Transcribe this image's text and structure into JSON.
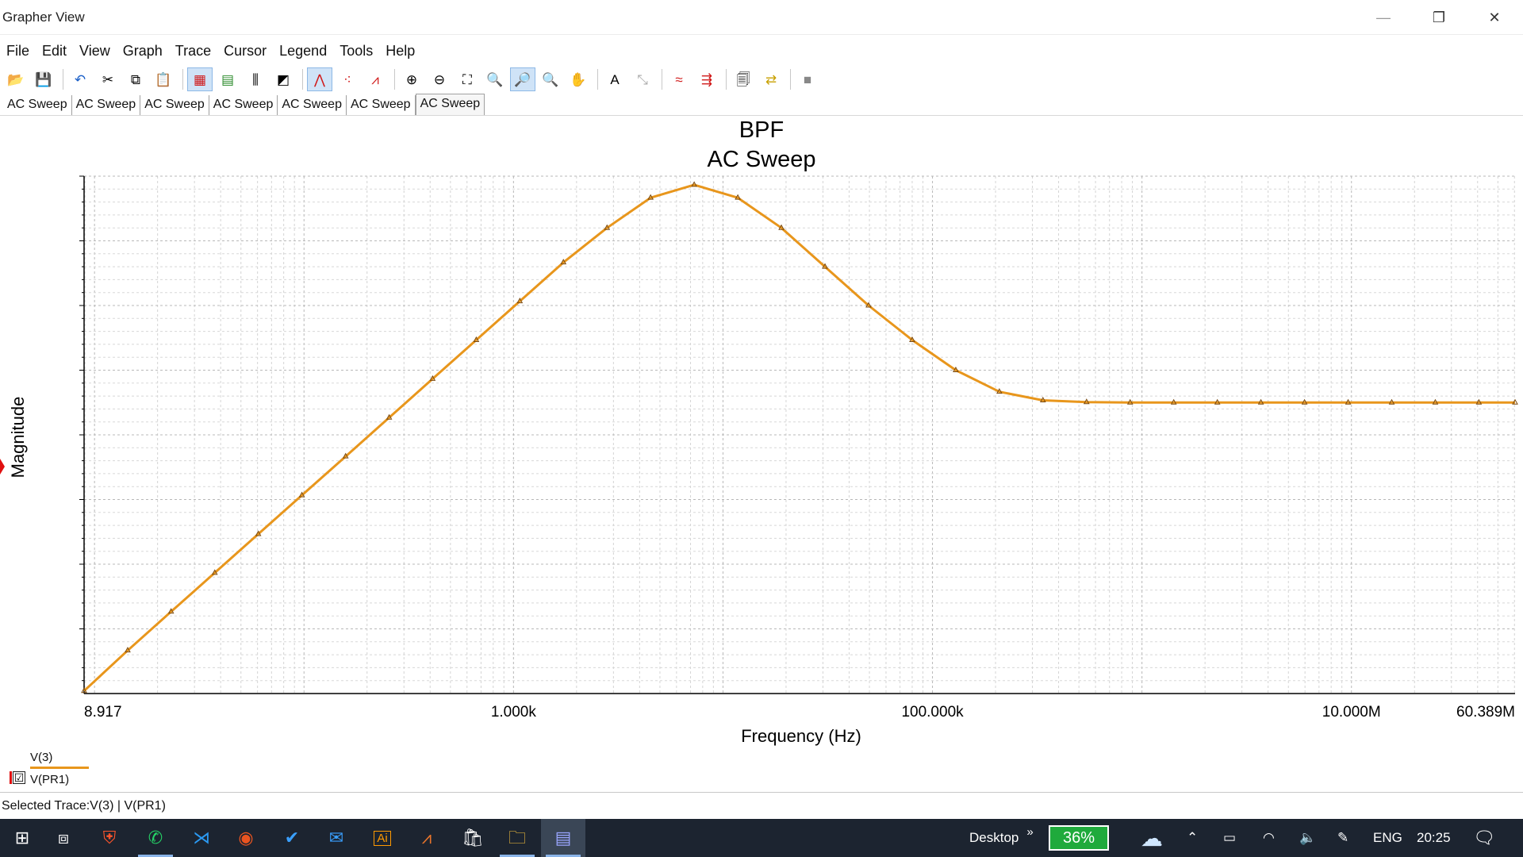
{
  "window": {
    "title": "Grapher View",
    "minimize_glyph": "—",
    "restore_glyph": "❐",
    "close_glyph": "✕"
  },
  "menu": [
    "File",
    "Edit",
    "View",
    "Graph",
    "Trace",
    "Cursor",
    "Legend",
    "Tools",
    "Help"
  ],
  "toolbar": [
    {
      "name": "open-icon",
      "glyph": "📂"
    },
    {
      "name": "save-icon",
      "glyph": "💾"
    },
    {
      "sep": true
    },
    {
      "name": "undo-icon",
      "glyph": "↶",
      "color": "#1a5fc8"
    },
    {
      "name": "cut-icon",
      "glyph": "✂"
    },
    {
      "name": "copy-icon",
      "glyph": "⧉"
    },
    {
      "name": "paste-icon",
      "glyph": "📋"
    },
    {
      "sep": true
    },
    {
      "name": "grid-icon",
      "glyph": "▦",
      "color": "#d01818",
      "active": true
    },
    {
      "name": "legend-icon",
      "glyph": "▤",
      "color": "#2a8a2a"
    },
    {
      "name": "ticks-icon",
      "glyph": "⫼"
    },
    {
      "name": "properties-icon",
      "glyph": "◩"
    },
    {
      "sep": true
    },
    {
      "name": "line-style-icon",
      "glyph": "⋀",
      "color": "#d01818",
      "active": true
    },
    {
      "name": "dot-style-icon",
      "glyph": "⁖",
      "color": "#d01818"
    },
    {
      "name": "line-dot-style-icon",
      "glyph": "⩘",
      "color": "#d01818"
    },
    {
      "sep": true
    },
    {
      "name": "zoom-in-icon",
      "glyph": "⊕"
    },
    {
      "name": "zoom-out-icon",
      "glyph": "⊖"
    },
    {
      "name": "zoom-area-icon",
      "glyph": "⛶"
    },
    {
      "name": "zoom-full-icon",
      "glyph": "🔍"
    },
    {
      "name": "zoom-x-icon",
      "glyph": "🔎",
      "active": true
    },
    {
      "name": "zoom-y-icon",
      "glyph": "🔍"
    },
    {
      "name": "pan-hand-icon",
      "glyph": "✋"
    },
    {
      "sep": true
    },
    {
      "name": "text-tool-icon",
      "glyph": "A"
    },
    {
      "name": "label-tool-icon",
      "glyph": "⤡",
      "color": "#aaaaaa"
    },
    {
      "sep": true
    },
    {
      "name": "overlay-traces-icon",
      "glyph": "≈",
      "color": "#d01818"
    },
    {
      "name": "export-icon",
      "glyph": "⇶",
      "color": "#d01818"
    },
    {
      "sep": true
    },
    {
      "name": "print-preview-icon",
      "glyph": "🗐"
    },
    {
      "name": "transfer-icon",
      "glyph": "⇄",
      "color": "#c8a000"
    },
    {
      "sep": true
    },
    {
      "name": "stop-icon",
      "glyph": "■",
      "color": "#888888"
    }
  ],
  "tabs": [
    "AC Sweep",
    "AC Sweep",
    "AC Sweep",
    "AC Sweep",
    "AC Sweep",
    "AC Sweep",
    "AC Sweep"
  ],
  "active_tab": 6,
  "chart_data": {
    "type": "line",
    "title": "BPF",
    "subtitle": "AC Sweep",
    "xlabel": "Frequency (Hz)",
    "ylabel": "Magnitude",
    "x_scale": "log",
    "xlim": [
      8.917,
      60389000
    ],
    "x_tick_values": [
      8.917,
      1000,
      100000,
      10000000,
      60389000
    ],
    "x_tick_labels": [
      "8.917",
      "1.000k",
      "100.000k",
      "10.000M",
      "60.389M"
    ],
    "y_tick_labels": [],
    "ylim": [
      0,
      1.2
    ],
    "grid": true,
    "trace_color": "#e8961c",
    "series": [
      {
        "name": "V(3)",
        "x": [
          8.917,
          14.4,
          23.2,
          37.5,
          60.5,
          97.7,
          158,
          255,
          411,
          664,
          1072,
          1731,
          2795,
          4513,
          7287,
          11770,
          19000,
          30680,
          49540,
          80000,
          129200,
          208600,
          336800,
          543800,
          878100,
          1418000,
          2290000,
          3697000,
          5970000,
          9640000,
          15570000,
          25130000,
          40580000,
          60389000
        ],
        "y": [
          0.006,
          0.1,
          0.19,
          0.28,
          0.37,
          0.46,
          0.55,
          0.64,
          0.73,
          0.82,
          0.91,
          1.0,
          1.08,
          1.15,
          1.18,
          1.15,
          1.08,
          0.99,
          0.9,
          0.82,
          0.75,
          0.7,
          0.68,
          0.676,
          0.675,
          0.675,
          0.675,
          0.675,
          0.675,
          0.675,
          0.675,
          0.675,
          0.675,
          0.675
        ]
      }
    ]
  },
  "legend": {
    "trace1": "V(3)",
    "trace2": "V(PR1)",
    "checked": "☑"
  },
  "status": "Selected Trace:V(3) | V(PR1)",
  "taskbar": {
    "apps": [
      {
        "name": "start-icon",
        "glyph": "⊞",
        "color": "#ffffff"
      },
      {
        "name": "task-view-icon",
        "glyph": "⧈",
        "color": "#ffffff"
      },
      {
        "name": "brave-icon",
        "glyph": "⛨",
        "color": "#fb542b"
      },
      {
        "name": "whatsapp-icon",
        "glyph": "✆",
        "color": "#25d366",
        "open": true
      },
      {
        "name": "vscode-icon",
        "glyph": "⋊",
        "color": "#2b9af3"
      },
      {
        "name": "ubuntu-icon",
        "glyph": "◉",
        "color": "#e95420"
      },
      {
        "name": "todo-icon",
        "glyph": "✔",
        "color": "#3aa0ff"
      },
      {
        "name": "mail-icon",
        "glyph": "✉",
        "color": "#3aa0ff"
      },
      {
        "name": "illustrator-icon",
        "glyph": "Ai",
        "color": "#ff9a00"
      },
      {
        "name": "matlab-icon",
        "glyph": "⩘",
        "color": "#e8742a"
      },
      {
        "name": "store-icon",
        "glyph": "🛍",
        "color": "#ffffff"
      },
      {
        "name": "file-explorer-icon",
        "glyph": "🗀",
        "color": "#ffc83d",
        "open": true
      },
      {
        "name": "multisim-icon",
        "glyph": "▤",
        "color": "#9aa6ff",
        "open": true,
        "active": true
      }
    ],
    "desktop_label": "Desktop",
    "desktop_chevron": "»",
    "battery_percent": "36%",
    "language": "ENG",
    "time": "20:25"
  }
}
